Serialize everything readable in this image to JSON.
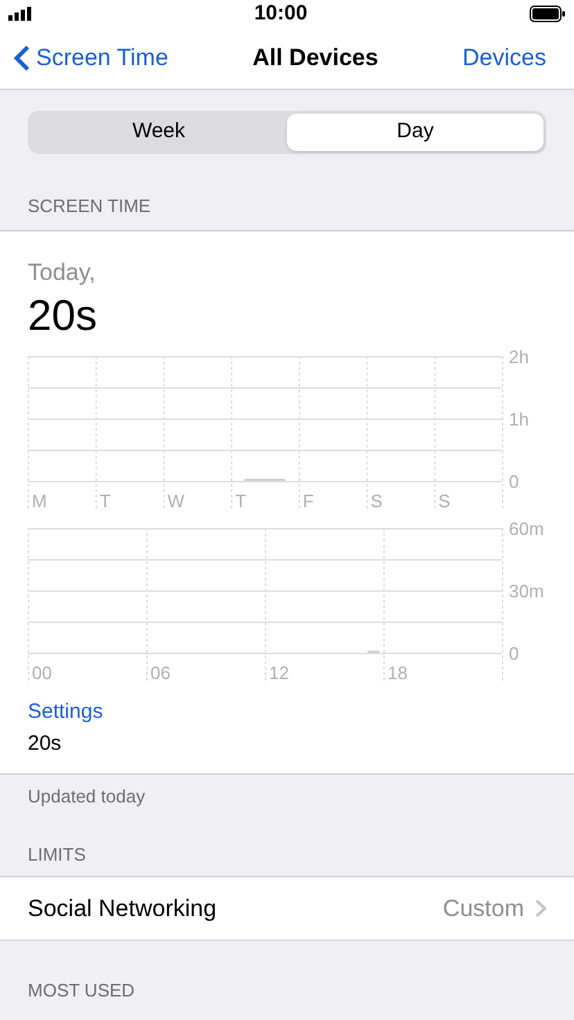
{
  "status_bar": {
    "time": "10:00"
  },
  "nav": {
    "back": "Screen Time",
    "title": "All Devices",
    "action": "Devices"
  },
  "segments": [
    {
      "label": "Week",
      "selected": false
    },
    {
      "label": "Day",
      "selected": true
    }
  ],
  "screen_time": {
    "header": "SCREEN TIME",
    "day": "Today,",
    "total": "20s",
    "weekly": {
      "chart_data": {
        "type": "bar",
        "categories": [
          "M",
          "T",
          "W",
          "T",
          "F",
          "S",
          "S"
        ],
        "values": [
          0,
          0,
          0,
          0.01,
          0,
          0,
          0
        ],
        "ylim": [
          0,
          2
        ],
        "yticks": [
          {
            "value": 0,
            "label": "0"
          },
          {
            "value": 1,
            "label": "1h"
          },
          {
            "value": 2,
            "label": "2h"
          }
        ]
      }
    },
    "hourly": {
      "chart_data": {
        "type": "bar",
        "x": [
          17
        ],
        "values": [
          0.3
        ],
        "xlim": [
          -0.7,
          23.3
        ],
        "ylim": [
          0,
          60
        ],
        "xticks": [
          {
            "value": 0,
            "label": "00"
          },
          {
            "value": 6,
            "label": "06"
          },
          {
            "value": 12,
            "label": "12"
          },
          {
            "value": 18,
            "label": "18"
          }
        ],
        "yticks": [
          {
            "value": 0,
            "label": "0"
          },
          {
            "value": 30,
            "label": "30m"
          },
          {
            "value": 60,
            "label": "60m"
          }
        ]
      }
    },
    "category": "Settings",
    "category_time": "20s",
    "footer": "Updated today"
  },
  "limits": {
    "header": "LIMITS",
    "rows": [
      {
        "label": "Social Networking",
        "value": "Custom"
      }
    ]
  },
  "most_used": {
    "header": "MOST USED"
  }
}
